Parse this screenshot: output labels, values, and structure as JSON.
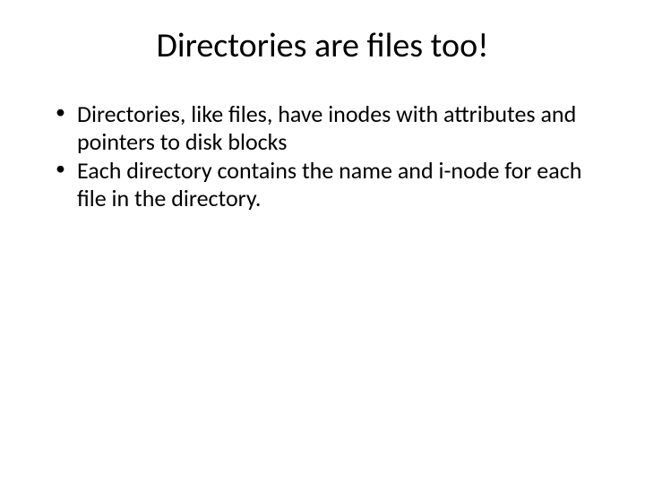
{
  "slide": {
    "title": "Directories are files too!",
    "bullets": [
      "Directories, like files, have inodes with attributes and pointers to disk blocks",
      "Each directory contains the name and i-node for each file in the directory."
    ]
  }
}
